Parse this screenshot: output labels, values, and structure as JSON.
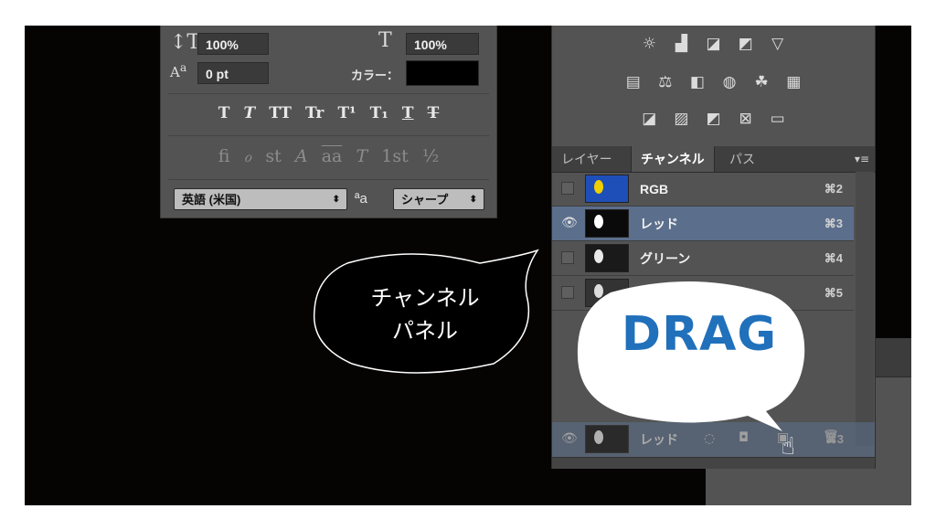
{
  "character_panel": {
    "vertical_scale": "100%",
    "horizontal_scale": "100%",
    "baseline_shift": "0 pt",
    "color_label": "カラー：",
    "style_glyphs": [
      "T",
      "T",
      "TT",
      "Tr",
      "T¹",
      "T₁",
      "T",
      "T"
    ],
    "opentype_glyphs": [
      "fi",
      "ℴ",
      "st",
      "A",
      "aa",
      "T",
      "1st",
      "½"
    ],
    "language": "英語 (米国)",
    "aa_icon": "ªa",
    "antialias": "シャープ"
  },
  "channels_panel": {
    "tabs": [
      "レイヤー",
      "チャンネル",
      "パス"
    ],
    "active_tab": "チャンネル",
    "channels": [
      {
        "name": "RGB",
        "shortcut": "⌘2",
        "visible": false,
        "selected": false,
        "bulb": "#f0d000",
        "bg": "#1e4fb8"
      },
      {
        "name": "レッド",
        "shortcut": "⌘3",
        "visible": true,
        "selected": true,
        "bulb": "#ffffff",
        "bg": "#0a0a0a"
      },
      {
        "name": "グリーン",
        "shortcut": "⌘4",
        "visible": false,
        "selected": false,
        "bulb": "#e8e8e8",
        "bg": "#1a1a1a"
      },
      {
        "name": "",
        "shortcut": "⌘5",
        "visible": false,
        "selected": false,
        "bulb": "#dddddd",
        "bg": "#333333"
      }
    ],
    "drag_ghost": {
      "name": "レッド",
      "shortcut": "⌘3"
    }
  },
  "callout": {
    "line1": "チャンネル",
    "line2": "パネル"
  },
  "drag_bubble": {
    "text": "DRAG"
  }
}
